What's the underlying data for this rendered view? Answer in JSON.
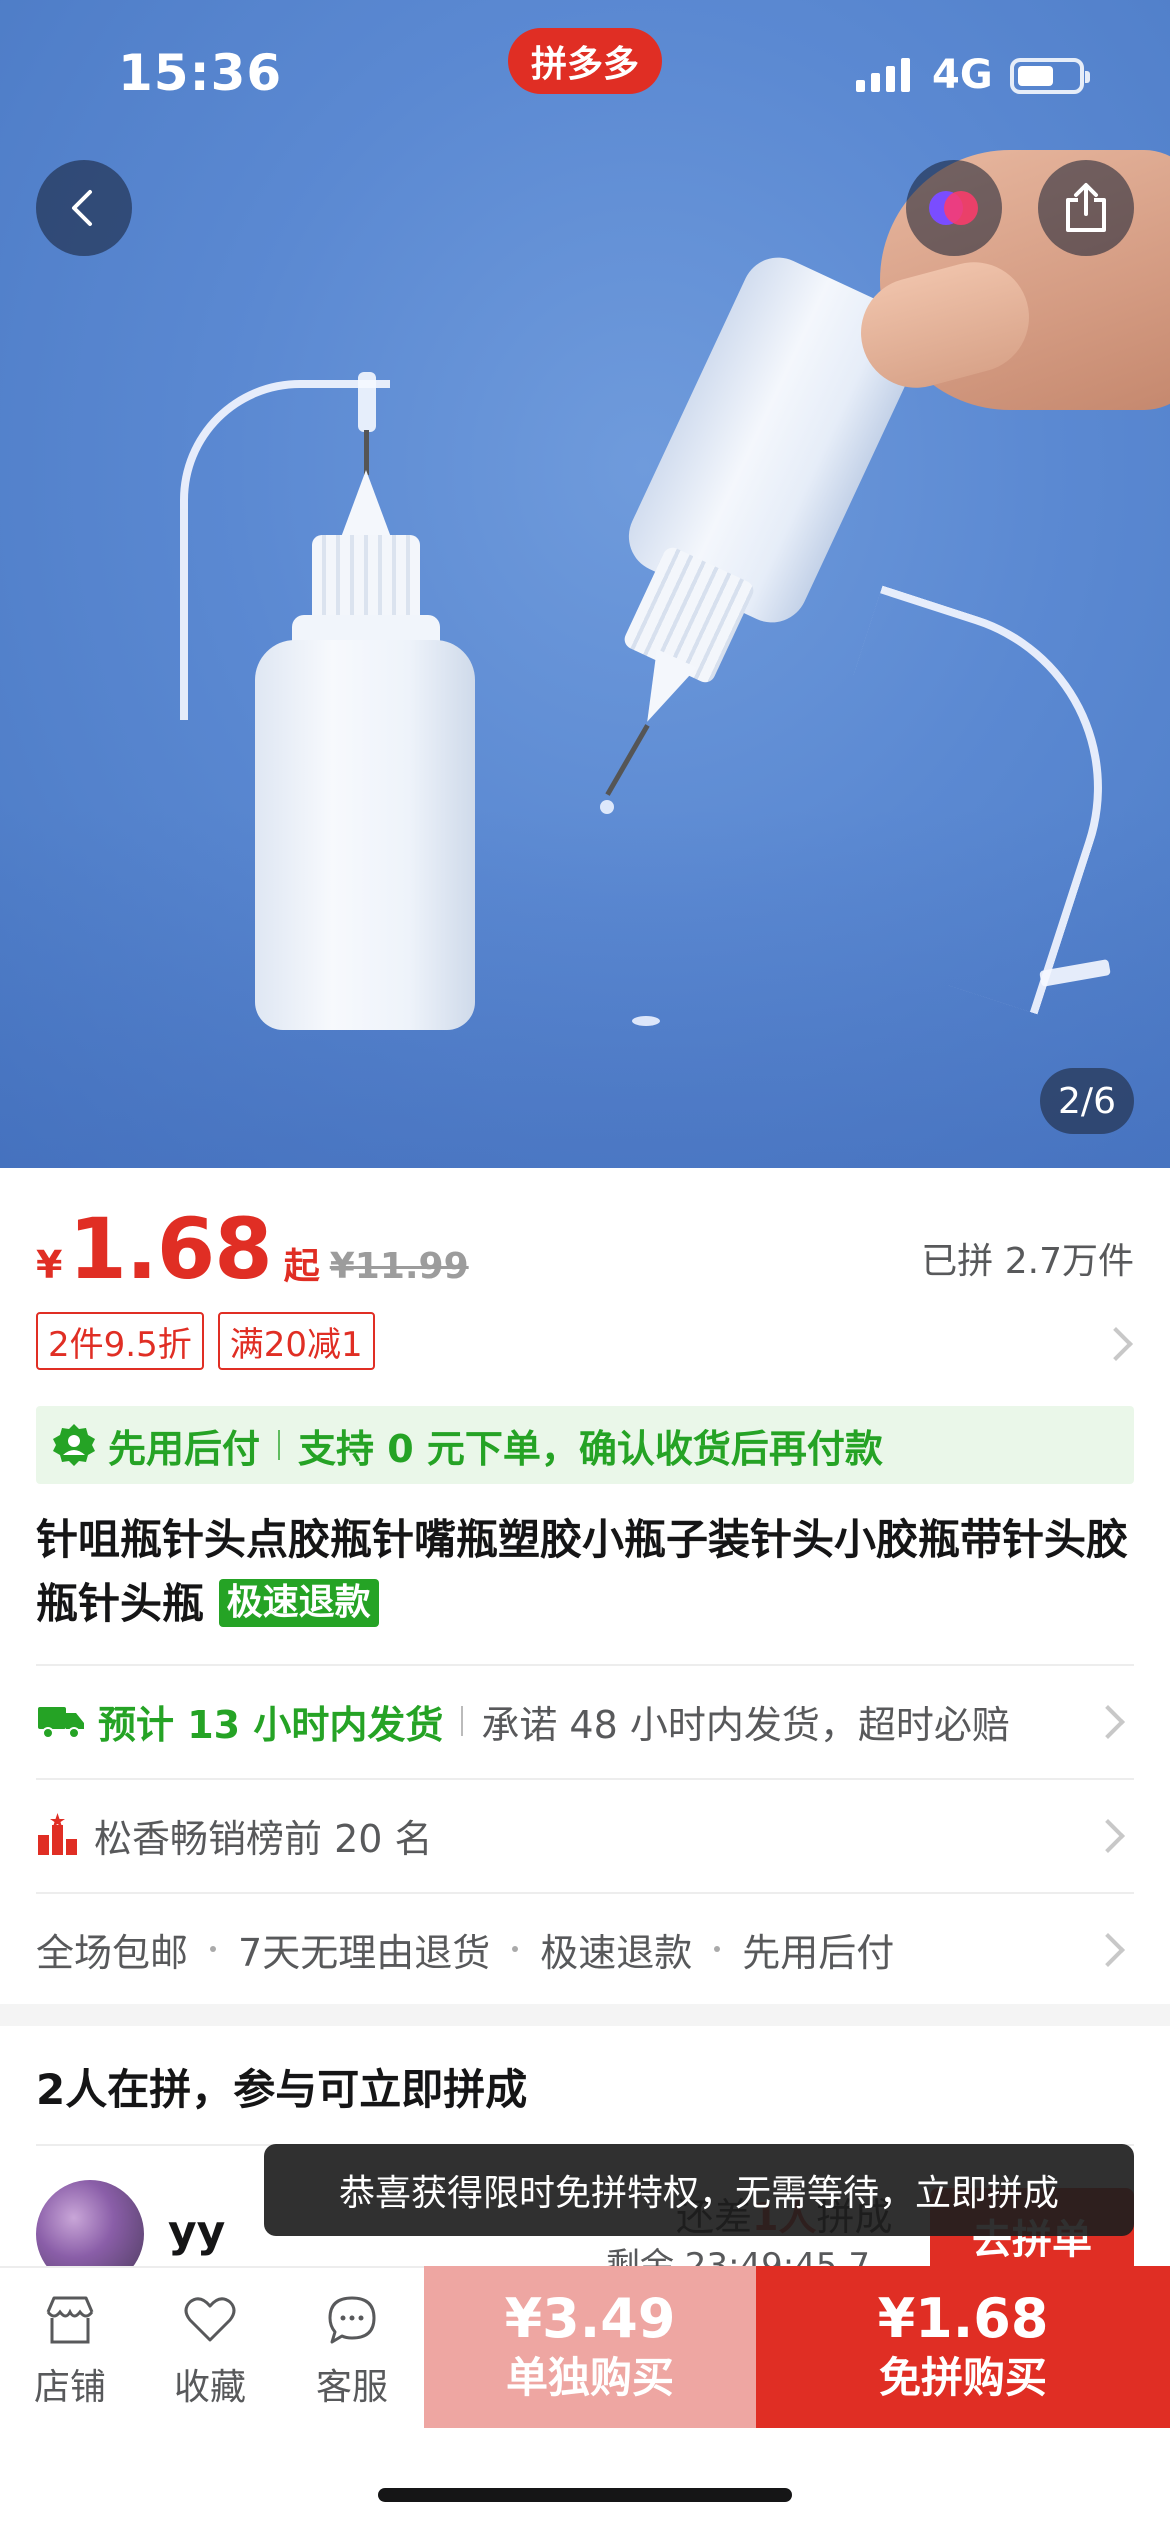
{
  "status_bar": {
    "time": "15:36",
    "brand": "拼多多",
    "network": "4G",
    "battery_level": 0.6
  },
  "gallery": {
    "counter": "2/6"
  },
  "price": {
    "symbol": "¥",
    "value": "1.68",
    "suffix": "起",
    "original": "¥11.99",
    "sold": "已拼 2.7万件"
  },
  "coupons": [
    "2件9.5折",
    "满20减1"
  ],
  "pay_later": {
    "label": "先用后付",
    "text": "支持 0 元下单，确认收货后再付款"
  },
  "product": {
    "title": "针咀瓶针头点胶瓶针嘴瓶塑胶小瓶子装针头小胶瓶带针头胶瓶针头瓶",
    "tag": "极速退款"
  },
  "shipping": {
    "estimate": "预计 13 小时内发货",
    "promise": "承诺 48 小时内发货，超时必赔"
  },
  "ranking": {
    "text": "松香畅销榜前 20 名"
  },
  "services": [
    "全场包邮",
    "7天无理由退货",
    "极速退款",
    "先用后付"
  ],
  "group": {
    "title": "2人在拼，参与可立即拼成",
    "user": "yy",
    "need_prefix": "还差",
    "need_count": "1人",
    "need_suffix": "拼成",
    "remaining": "剩余 23:49:45.7",
    "join_label": "去拼单"
  },
  "toast": "恭喜获得限时免拼特权，无需等待，立即拼成",
  "bottom_nav": [
    {
      "label": "店铺",
      "icon": "store-icon"
    },
    {
      "label": "收藏",
      "icon": "heart-icon"
    },
    {
      "label": "客服",
      "icon": "chat-icon"
    }
  ],
  "buy_alone": {
    "price": "¥3.49",
    "label": "单独购买"
  },
  "buy_group": {
    "price": "¥1.68",
    "label": "免拼购买"
  },
  "colors": {
    "brand_red": "#e02e24",
    "green": "#25a325",
    "pink": "#eea6a2"
  }
}
